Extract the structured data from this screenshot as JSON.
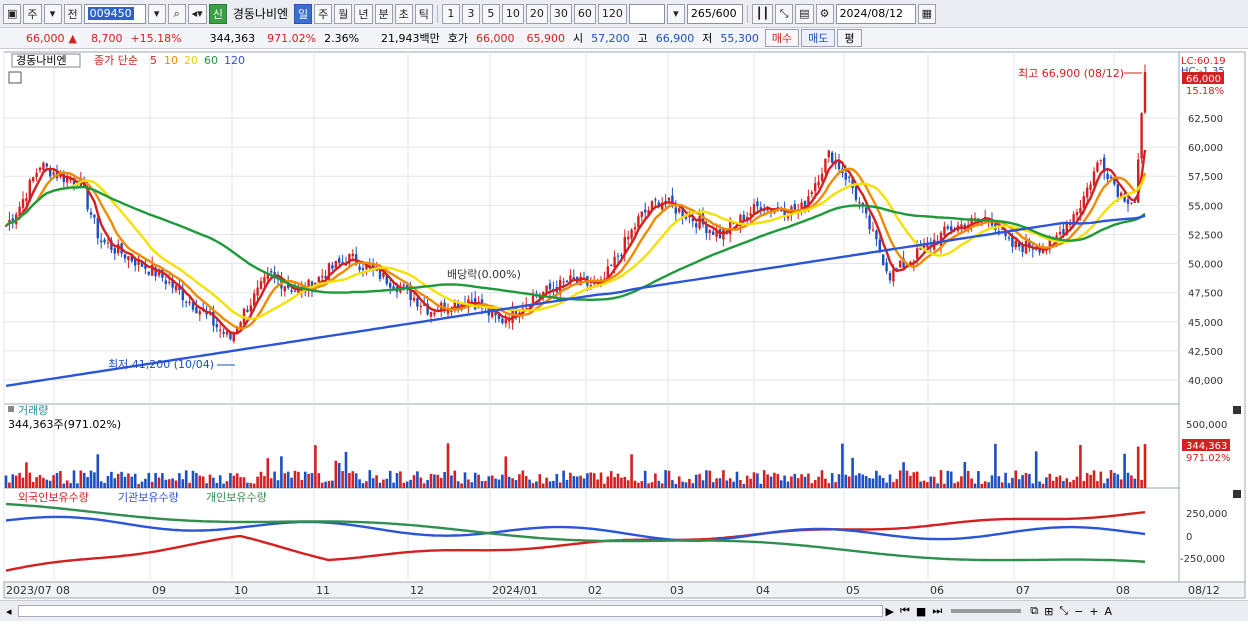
{
  "toolbar": {
    "market": "주",
    "prev": "전",
    "code": "009450",
    "badge": "신",
    "name": "경동나비엔",
    "periods": [
      "일",
      "주",
      "월",
      "년",
      "분",
      "초",
      "틱"
    ],
    "active_period": "일",
    "numbers": [
      "1",
      "3",
      "5",
      "10",
      "20",
      "30",
      "60",
      "120"
    ],
    "count": "265",
    "total": "/600",
    "date": "2024/08/12"
  },
  "quote": {
    "price": "66,000",
    "arrow": "▲",
    "change": "8,700",
    "change_pct": "+15.18%",
    "volume": "344,363",
    "volume_pct": "971.02%",
    "turnover": "2.36%",
    "amount": "21,943백만",
    "bid_label": "호가",
    "bid": "66,000",
    "ask": "65,900",
    "open_label": "시",
    "open": "57,200",
    "high_label": "고",
    "high": "66,900",
    "low_label": "저",
    "low": "55,300",
    "buy_label": "매수",
    "sell_label": "매도",
    "avg_label": "평"
  },
  "price_panel": {
    "legend_name": "경동나비엔",
    "legend_ma": "종가 단순",
    "ma_periods": [
      "5",
      "10",
      "20",
      "60",
      "120"
    ],
    "lc_label": "LC:60.19",
    "hc_label": "HC:-1.35",
    "current_price_label": "66,000",
    "current_pct_label": "15.18%",
    "high_annotation": "최고 66,900 (08/12)",
    "low_annotation": "최저 41,200 (10/04)",
    "dividend_annotation": "배당락(0.00%)",
    "y_ticks": [
      "62,500",
      "60,000",
      "57,500",
      "55,000",
      "52,500",
      "50,000",
      "47,500",
      "45,000",
      "42,500",
      "40,000"
    ]
  },
  "volume_panel": {
    "title": "거래량",
    "value": "344,363주(971.02%)",
    "y_tick": "500,000",
    "current_label": "344,363",
    "current_pct": "971.02%"
  },
  "holdings_panel": {
    "legend": [
      "외국인보유수량",
      "기관보유수량",
      "개인보유수량"
    ],
    "y_ticks": [
      "250,000",
      "0",
      "-250,000"
    ]
  },
  "x_axis": {
    "labels": [
      "2023/07",
      "08",
      "09",
      "10",
      "11",
      "12",
      "2024/01",
      "02",
      "03",
      "04",
      "05",
      "06",
      "07",
      "08"
    ],
    "right_label": "08/12"
  },
  "colors": {
    "up": "#d42020",
    "down": "#1c4fc0",
    "ma5": "#d42020",
    "ma10": "#f08a00",
    "ma20": "#f5e000",
    "ma60": "#1f9a3a",
    "ma120": "#2a55d8",
    "foreign": "#d42020",
    "institution": "#2a55d8",
    "individual": "#2f8f4f"
  }
}
